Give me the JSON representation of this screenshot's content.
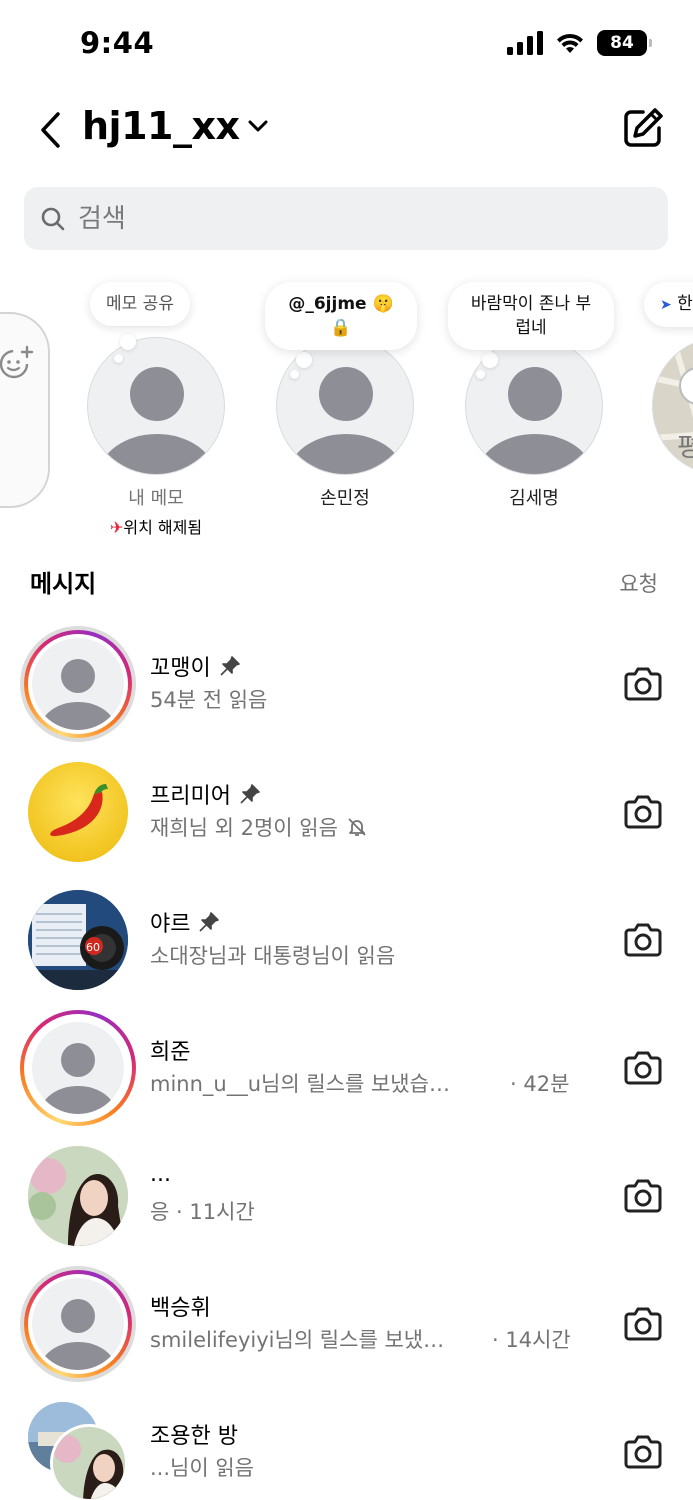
{
  "status_bar": {
    "time": "9:44",
    "battery": "84"
  },
  "header": {
    "account_name": "hj11_xx"
  },
  "search": {
    "placeholder": "검색"
  },
  "notes": [
    {
      "bubble": "메모 공유",
      "name": "내 메모",
      "location": "위치 해제됨"
    },
    {
      "bubble": "@_6jjme 🤫🔒",
      "name": "손민정"
    },
    {
      "bubble_line1": "바람막이 존나 부",
      "bubble_line2": "럽네",
      "name": "김세명"
    },
    {
      "bubble": "한"
    }
  ],
  "messages": {
    "title": "메시지",
    "requests": "요청",
    "conversations": [
      {
        "name": "꼬맹이",
        "pinned": true,
        "subtitle": "54분 전 읽음"
      },
      {
        "name": "프리미어",
        "pinned": true,
        "subtitle": "재희님 외 2명이 읽음",
        "muted": true
      },
      {
        "name": "야르",
        "pinned": true,
        "subtitle": "소대장님과 대통령님이 읽음"
      },
      {
        "name": "희준",
        "subtitle": "minn_u__u님의 릴스를 보냈습…",
        "time": "· 42분"
      },
      {
        "name": "...",
        "subtitle": "응 · 11시간"
      },
      {
        "name": "백승휘",
        "subtitle": "smilelifeyiyi님의 릴스를 보냈…",
        "time": "· 14시간"
      },
      {
        "name": "조용한 방",
        "subtitle": "...님이 읽음"
      }
    ]
  },
  "icons": {
    "back": "chevron-left-icon",
    "dropdown": "chevron-down-icon",
    "compose": "compose-icon",
    "search": "search-icon",
    "pin": "pin-icon",
    "mute": "bell-off-icon",
    "camera": "camera-icon",
    "location": "location-off-icon"
  },
  "colors": {
    "story_ring_start": "#feda75",
    "story_ring_mid": "#d62976",
    "muted_text": "#737373",
    "search_bg": "#eef0f2"
  }
}
